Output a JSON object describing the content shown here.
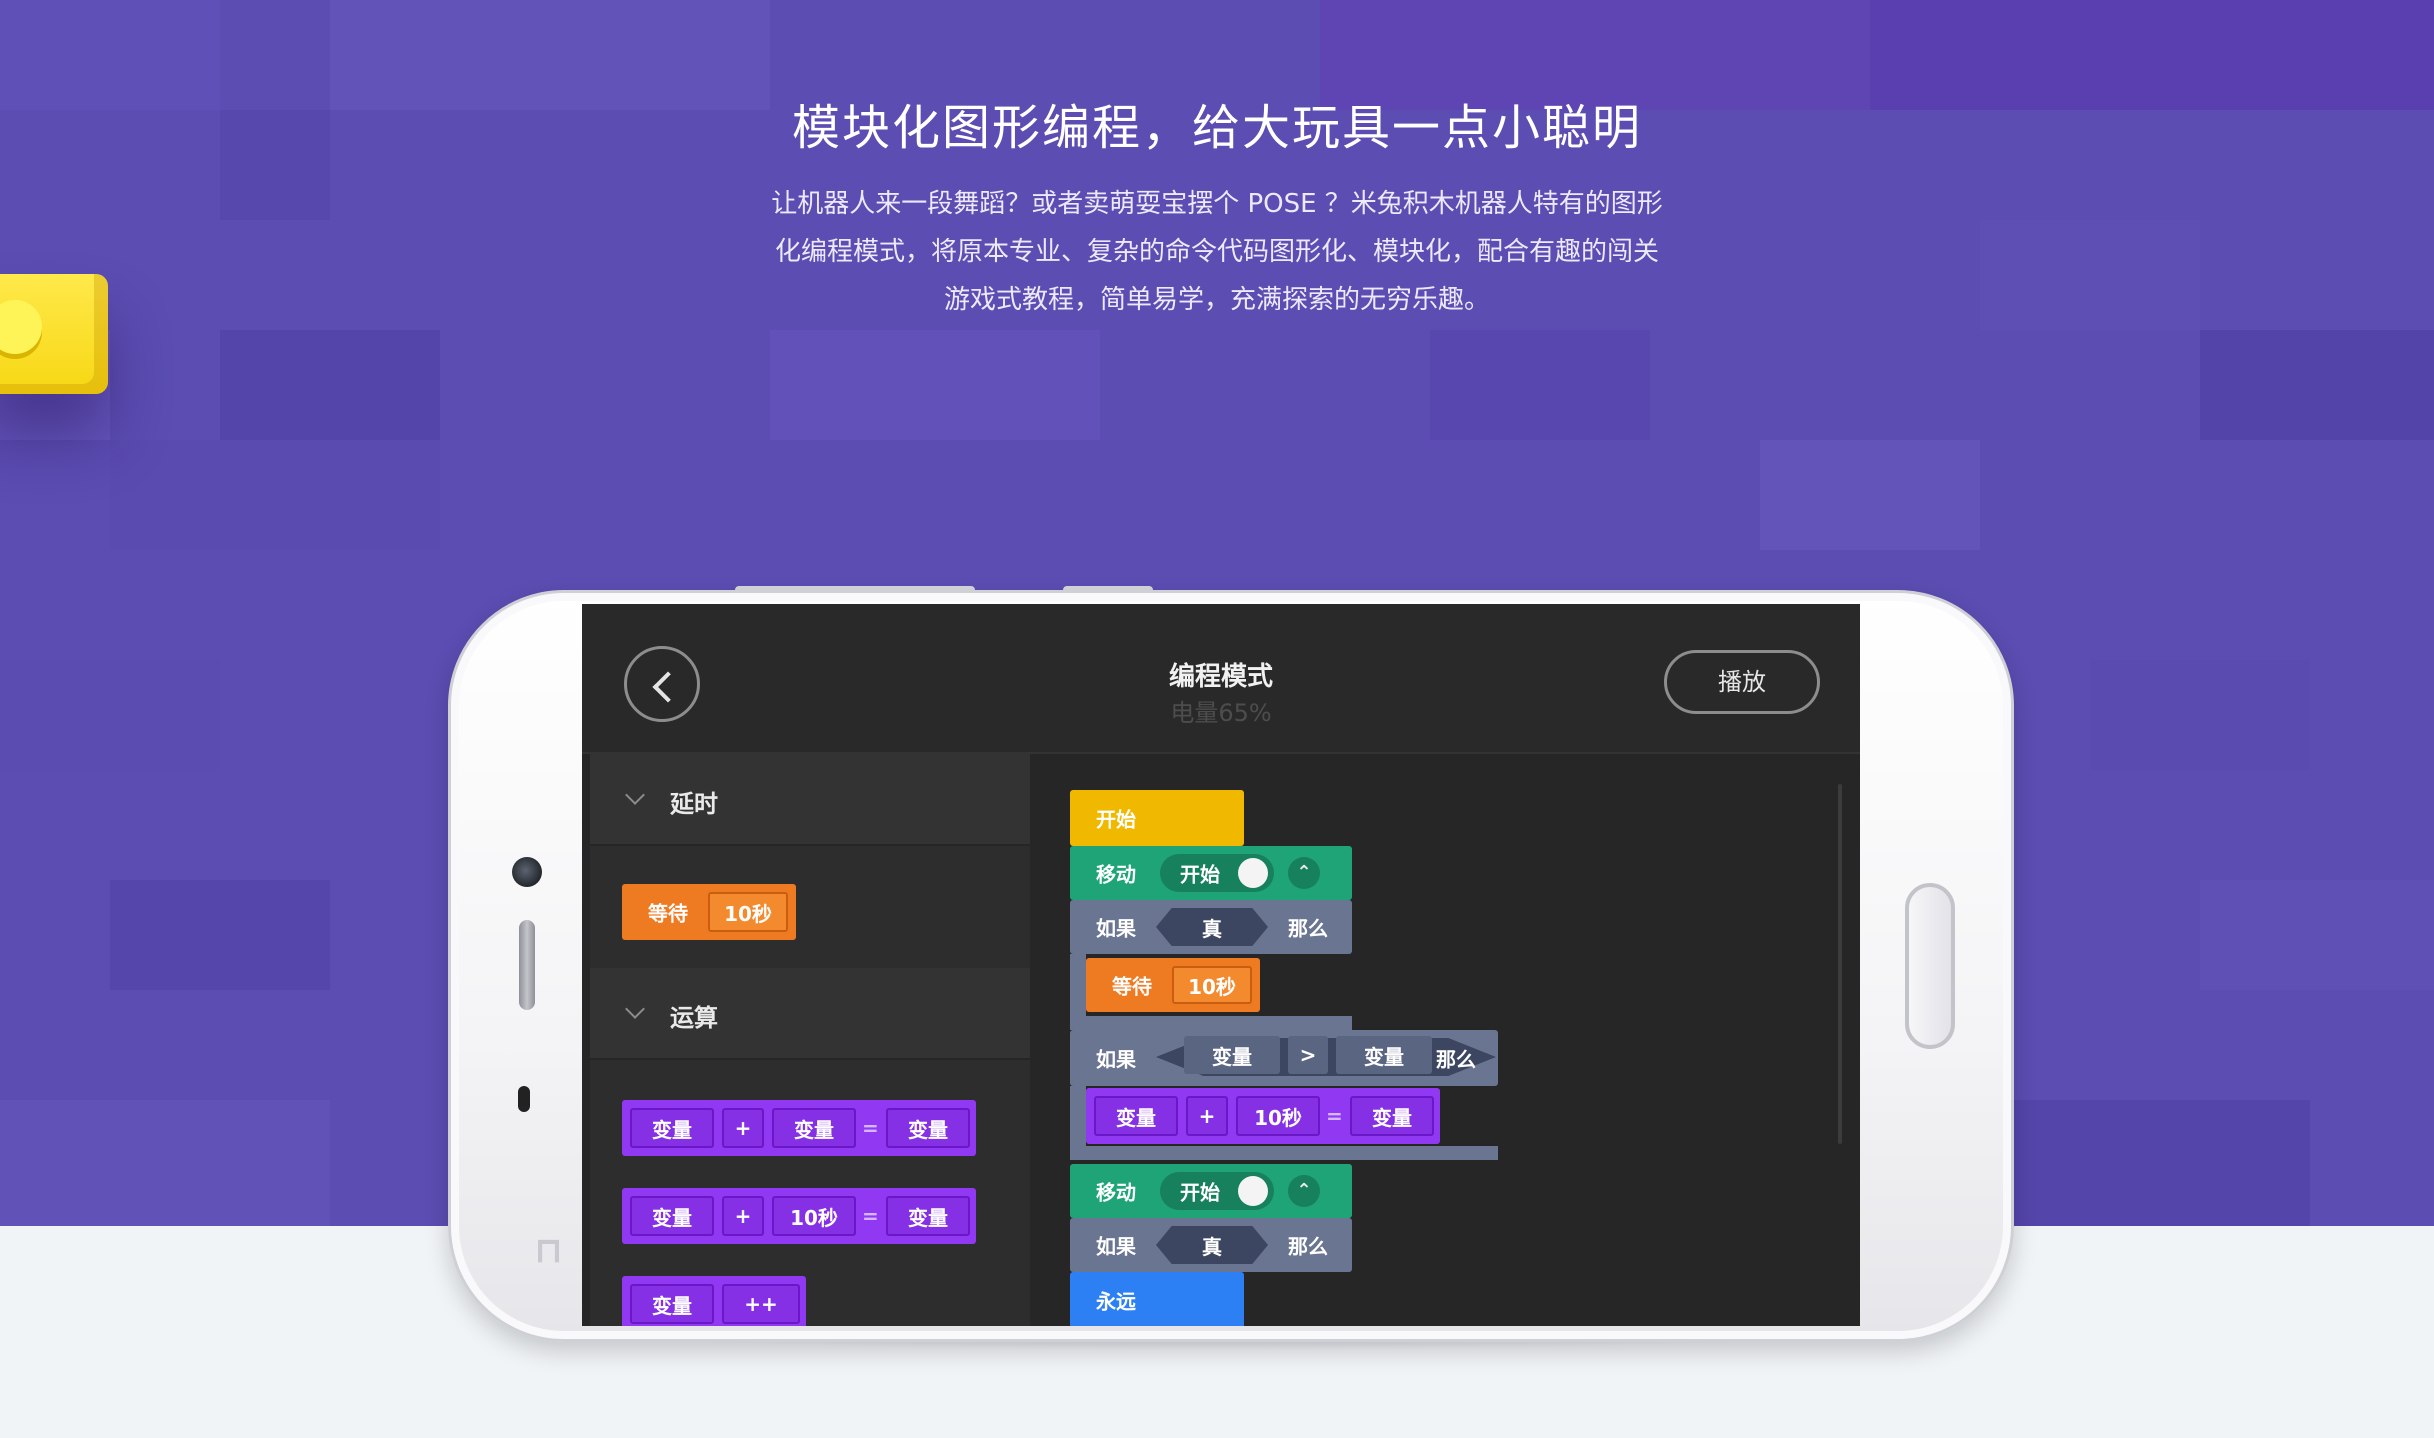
{
  "hero": {
    "title": "模块化图形编程，给大玩具一点小聪明",
    "description_lines": [
      "让机器人来一段舞蹈？或者卖萌耍宝摆个 POSE ？米兔积木机器人特有的图形",
      "化编程模式，将原本专业、复杂的命令代码图形化、模块化，配合有趣的闯关",
      "游戏式教程，简单易学，充满探索的无穷乐趣。"
    ]
  },
  "colors": {
    "hero_bg": "#5b4db2",
    "bottom_bg": "#f1f4f7",
    "block_orange": "#ee7a22",
    "block_purple": "#9138f2",
    "block_green": "#1ea477",
    "block_gray": "#6a7591",
    "block_yellow": "#f1b800",
    "block_blue": "#2d7ff4"
  },
  "phone": {
    "brand_mark": "mi-logo"
  },
  "app": {
    "header": {
      "back_icon": "chevron-left-icon",
      "title": "编程模式",
      "battery": "电量65%",
      "play_label": "播放"
    },
    "palette": {
      "sections": [
        {
          "label": "延时"
        },
        {
          "label": "运算"
        }
      ],
      "wait_block": {
        "label": "等待",
        "value": "10秒"
      },
      "math_block_1": {
        "a": "变量",
        "op": "+",
        "b": "变量",
        "eq": "=",
        "c": "变量"
      },
      "math_block_2": {
        "a": "变量",
        "op": "+",
        "b": "10秒",
        "eq": "=",
        "c": "变量"
      },
      "inc_block": {
        "a": "变量",
        "op": "++"
      }
    },
    "workspace": {
      "start_label": "开始",
      "move_1": {
        "label": "移动",
        "toggle": "开始",
        "caret": "⌃"
      },
      "if_1": {
        "label": "如果",
        "cond": "真",
        "then": "那么"
      },
      "wait": {
        "label": "等待",
        "value": "10秒"
      },
      "if_2": {
        "label": "如果",
        "left": "变量",
        "op": ">",
        "right": "变量",
        "then": "那么"
      },
      "math": {
        "a": "变量",
        "op": "+",
        "b": "10秒",
        "eq": "=",
        "c": "变量"
      },
      "move_2": {
        "label": "移动",
        "toggle": "开始",
        "caret": "⌃"
      },
      "if_3": {
        "label": "如果",
        "cond": "真",
        "then": "那么"
      },
      "forever_label": "永远"
    }
  }
}
